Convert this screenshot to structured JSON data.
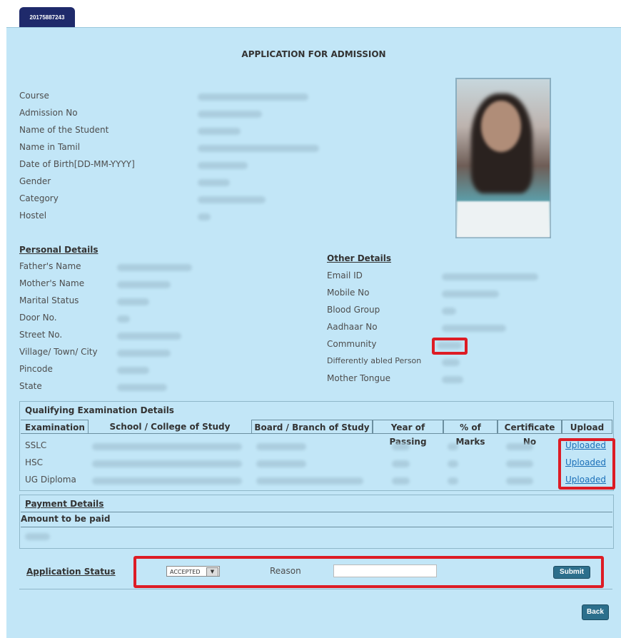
{
  "tab": {
    "label": "20175887243"
  },
  "page_title": "APPLICATION FOR ADMISSION",
  "basic_fields": [
    {
      "label": "Course"
    },
    {
      "label": "Admission No"
    },
    {
      "label": "Name of the Student"
    },
    {
      "label": "Name in Tamil"
    },
    {
      "label": "Date of Birth[DD-MM-YYYY]"
    },
    {
      "label": "Gender"
    },
    {
      "label": "Category"
    },
    {
      "label": "Hostel"
    }
  ],
  "personal": {
    "heading": "Personal Details",
    "fields": [
      "Father's Name",
      "Mother's Name",
      "Marital Status",
      "Door No.",
      "Street No.",
      "Village/ Town/ City",
      "Pincode",
      "State"
    ]
  },
  "other": {
    "heading": "Other Details",
    "fields": [
      "Email ID",
      "Mobile No",
      "Blood Group",
      "Aadhaar No",
      "Community",
      "Differently abled Person",
      "Mother Tongue"
    ]
  },
  "qualifying": {
    "heading": "Qualifying Examination Details",
    "columns": [
      "Examination",
      "School / College of Study",
      "Board / Branch of Study",
      "Year of Passing",
      "% of Marks",
      "Certificate No",
      "Upload"
    ],
    "rows": [
      {
        "exam": "SSLC",
        "upload": "Uploaded"
      },
      {
        "exam": "HSC",
        "upload": "Uploaded"
      },
      {
        "exam": "UG Diploma",
        "upload": "Uploaded"
      }
    ]
  },
  "payment": {
    "heading": "Payment Details",
    "amount_label": "Amount to be paid"
  },
  "status": {
    "label": "Application Status",
    "selected": "ACCEPTED",
    "reason_label": "Reason",
    "submit": "Submit"
  },
  "back": "Back",
  "colors": {
    "highlight": "#dd1c25",
    "panel": "#c2e6f7",
    "tab": "#1f2a6b"
  }
}
